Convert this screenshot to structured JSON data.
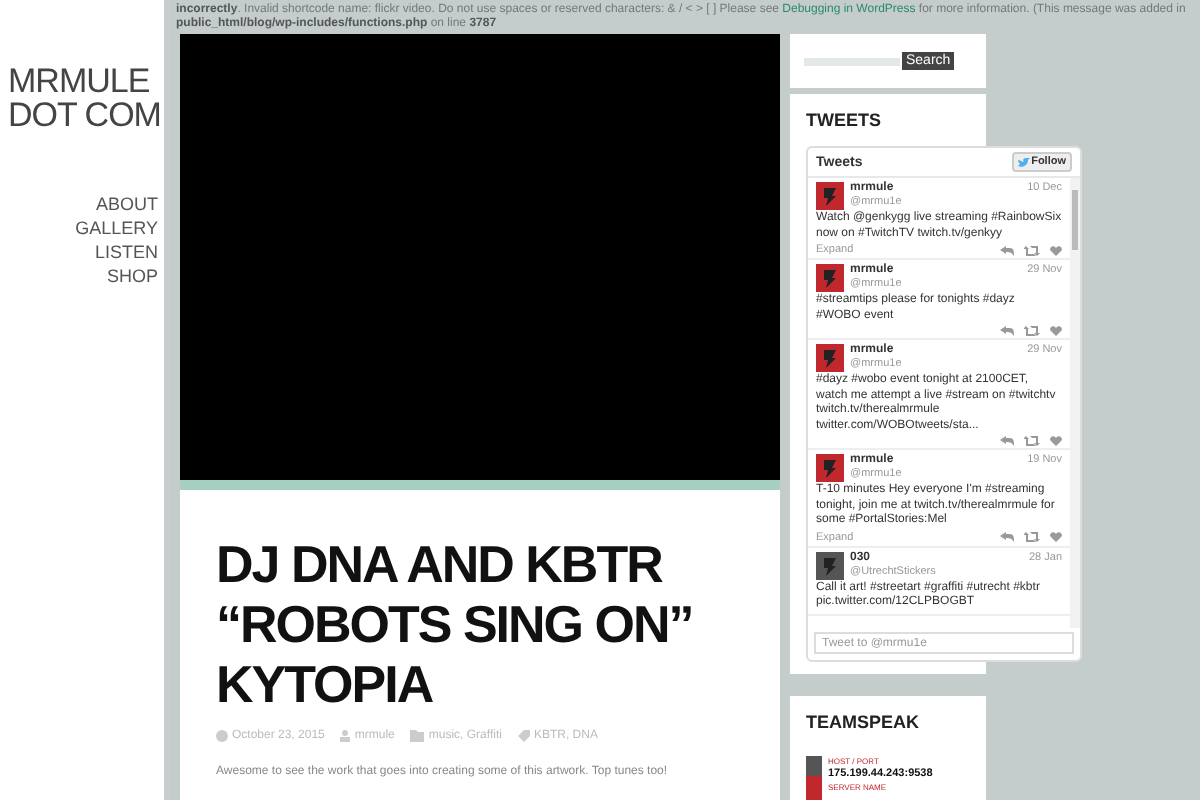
{
  "site": {
    "title_lines": [
      "MRMULE",
      "DOT COM"
    ]
  },
  "nav": [
    {
      "label": "ABOUT"
    },
    {
      "label": "GALLERY"
    },
    {
      "label": "LISTEN"
    },
    {
      "label": "SHOP"
    }
  ],
  "notice": {
    "lead": "incorrectly",
    "text": ". Invalid shortcode name: flickr video. Do not use spaces or reserved characters: & / < > [ ] Please see",
    "link": "Debugging in WordPress",
    "tail": "for more information. (This message was added in",
    "path": "public_html/blog/wp-includes/functions.php",
    "on_line": "on line",
    "line": "3787"
  },
  "post": {
    "title_lines": [
      "DJ DNA AND KBTR",
      "“ROBOTS SING ON”",
      "KYTOPIA"
    ],
    "date": "October 23, 2015",
    "author": "mrmule",
    "categories": "music, Graffiti",
    "tags": "KBTR, DNA",
    "body": "Awesome to see the work that goes into creating some of this artwork. Top tunes too!"
  },
  "search": {
    "button": "Search"
  },
  "tweets_widget": {
    "title": "TWEETS",
    "header": "Tweets",
    "follow": "Follow",
    "compose_placeholder": "Tweet to @mrmu1e",
    "tweets": [
      {
        "name": "mrmule",
        "handle": "@mrmu1e",
        "date": "10 Dec",
        "text": "Watch @genkygg live streaming #RainbowSix now on #TwitchTV twitch.tv/genkyy",
        "expand": "Expand",
        "color": "#c0282d"
      },
      {
        "name": "mrmule",
        "handle": "@mrmu1e",
        "date": "29 Nov",
        "text": "#streamtips please for tonights #dayz #WOBO event",
        "color": "#c0282d"
      },
      {
        "name": "mrmule",
        "handle": "@mrmu1e",
        "date": "29 Nov",
        "text": "#dayz #wobo event tonight at 2100CET, watch me attempt a live #stream on #twitchtv twitch.tv/therealmrmule twitter.com/WOBOtweets/sta...",
        "color": "#c0282d"
      },
      {
        "name": "mrmule",
        "handle": "@mrmu1e",
        "date": "19 Nov",
        "text": "T-10 minutes Hey everyone I'm #streaming tonight, join me at twitch.tv/therealmrmule for some #PortalStories:Mel",
        "expand": "Expand",
        "color": "#c0282d"
      },
      {
        "name": "030",
        "handle": "@UtrechtStickers",
        "date": "28 Jan",
        "text": "Call it art! #streetart #graffiti #utrecht #kbtr pic.twitter.com/12CLPBOGBT",
        "color": "#555555"
      }
    ]
  },
  "teamspeak": {
    "title": "TEAMSPEAK",
    "host_label": "HOST / PORT",
    "host": "175.199.44.243:9538",
    "server_label": "SERVER NAME"
  }
}
